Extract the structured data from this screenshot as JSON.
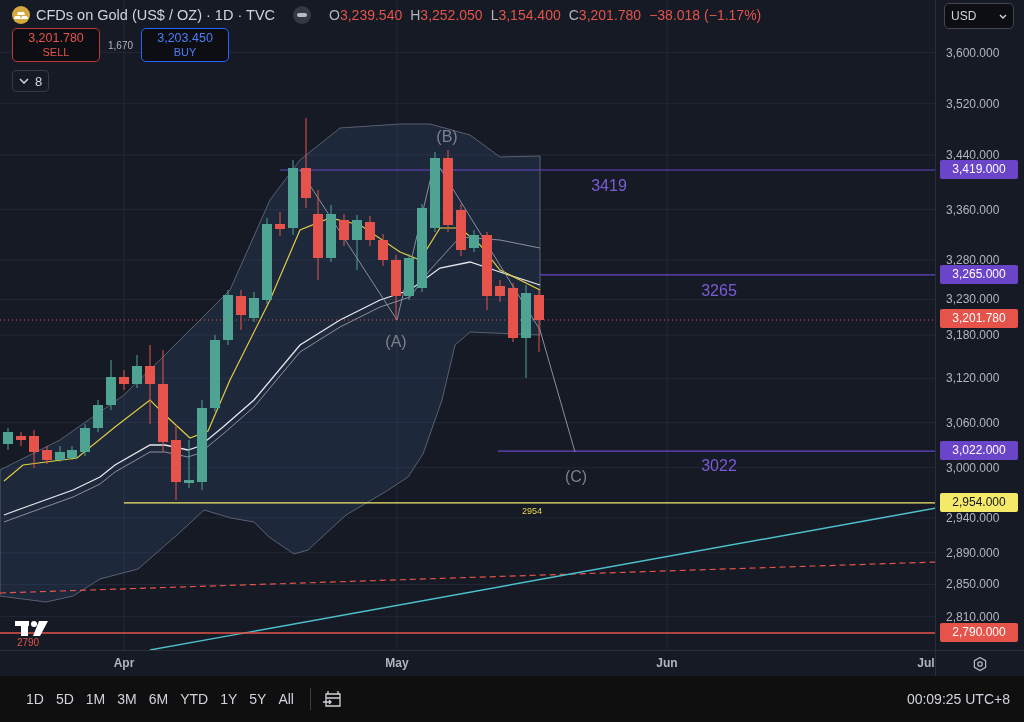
{
  "legend": {
    "title": "CFDs on Gold (US$ / OZ) · 1D · TVC",
    "ohlc": [
      {
        "key": "O",
        "value": "3,239.540"
      },
      {
        "key": "H",
        "value": "3,252.050"
      },
      {
        "key": "L",
        "value": "3,154.400"
      },
      {
        "key": "C",
        "value": "3,201.780"
      }
    ],
    "change": "−38.018 (−1.17%)"
  },
  "trade": {
    "sell": {
      "price": "3,201.780",
      "label": "SELL"
    },
    "spread": "1,670",
    "buy": {
      "price": "3,203.450",
      "label": "BUY"
    }
  },
  "indicators_toggle": {
    "count": "8"
  },
  "currency": {
    "value": "USD"
  },
  "chart_labels": [
    {
      "text": "(A)"
    },
    {
      "text": "(B)"
    },
    {
      "text": "(C)"
    },
    {
      "text": "3419"
    },
    {
      "text": "3265"
    },
    {
      "text": "3022"
    },
    {
      "text": "2954"
    },
    {
      "text": "2790"
    }
  ],
  "price_ticks": [
    "3,600.000",
    "3,520.000",
    "3,440.000",
    "3,360.000",
    "3,280.000",
    "3,230.000",
    "3,180.000",
    "3,120.000",
    "3,060.000",
    "3,000.000",
    "2,940.000",
    "2,890.000",
    "2,850.000",
    "2,810.000"
  ],
  "price_tags": [
    {
      "text": "3,419.000",
      "color": "#6a45c9"
    },
    {
      "text": "3,265.000",
      "color": "#6a45c9"
    },
    {
      "text": "3,201.780",
      "color": "#e5534b"
    },
    {
      "text": "3,022.000",
      "color": "#6a45c9"
    },
    {
      "text": "2,954.000",
      "color": "#f5e96a"
    },
    {
      "text": "2,790.000",
      "color": "#e5534b"
    }
  ],
  "time_axis": [
    "Apr",
    "May",
    "Jun",
    "Jul"
  ],
  "ranges": [
    {
      "label": "1D"
    },
    {
      "label": "5D"
    },
    {
      "label": "1M"
    },
    {
      "label": "3M"
    },
    {
      "label": "6M"
    },
    {
      "label": "YTD"
    },
    {
      "label": "1Y"
    },
    {
      "label": "5Y"
    },
    {
      "label": "All"
    }
  ],
  "clock": "00:09:25 UTC+8"
}
